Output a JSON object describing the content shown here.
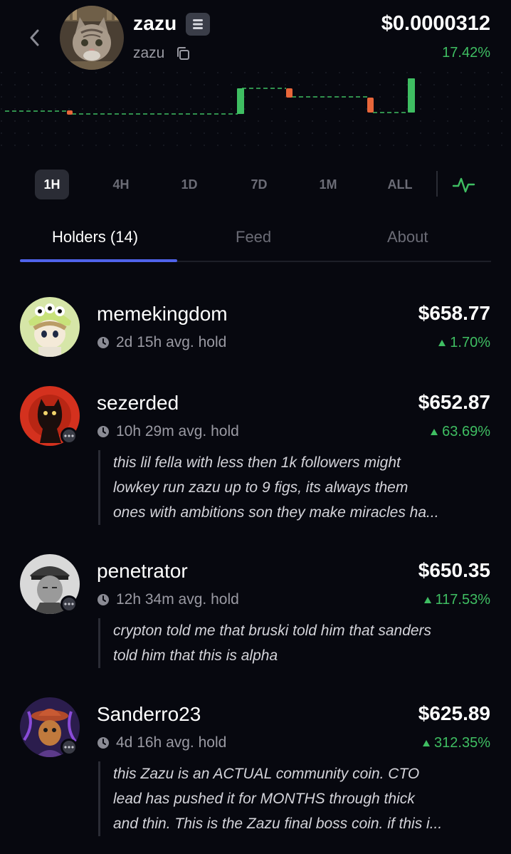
{
  "header": {
    "token_name": "zazu",
    "token_ticker": "zazu",
    "price": "$0.0000312",
    "price_change": "17.42%",
    "colors": {
      "positive": "#3fbe62",
      "negative": "#e8663a",
      "accent": "#4f63ea",
      "background": "#07080f"
    }
  },
  "timeframes": [
    {
      "label": "1H",
      "active": true
    },
    {
      "label": "4H",
      "active": false
    },
    {
      "label": "1D",
      "active": false
    },
    {
      "label": "7D",
      "active": false
    },
    {
      "label": "1M",
      "active": false
    },
    {
      "label": "ALL",
      "active": false
    }
  ],
  "tabs": [
    {
      "label": "Holders (14)",
      "active": true
    },
    {
      "label": "Feed",
      "active": false
    },
    {
      "label": "About",
      "active": false
    }
  ],
  "holders": [
    {
      "name": "memekingdom",
      "hold": "2d 15h avg. hold",
      "value": "$658.77",
      "change": "1.70%",
      "comment": null
    },
    {
      "name": "sezerded",
      "hold": "10h 29m avg. hold",
      "value": "$652.87",
      "change": "63.69%",
      "comment": [
        "this lil fella with less then 1k followers might",
        "lowkey run zazu up to 9 figs, its always them",
        "ones with ambitions son they make miracles ha..."
      ]
    },
    {
      "name": "penetrator",
      "hold": "12h 34m avg. hold",
      "value": "$650.35",
      "change": "117.53%",
      "comment": [
        "crypton told me that bruski told him that sanders",
        "told him that this is alpha"
      ]
    },
    {
      "name": "Sanderro23",
      "hold": "4d 16h avg. hold",
      "value": "$625.89",
      "change": "312.35%",
      "comment": [
        "this Zazu is an ACTUAL community coin. CTO",
        "lead has pushed it for MONTHS through thick",
        "and thin. This is the Zazu final boss coin. if this i..."
      ]
    }
  ],
  "icons": {
    "back": "chevron-left-icon",
    "copy": "copy-icon",
    "badge": "menu-lines-icon",
    "clock": "clock-icon",
    "chart_toggle": "activity-icon",
    "chat": "chat-icon"
  }
}
